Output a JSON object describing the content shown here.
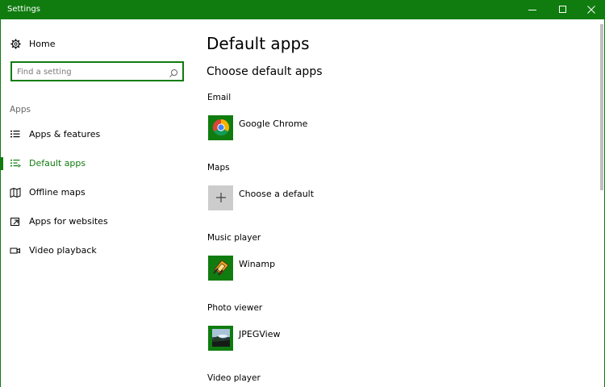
{
  "window": {
    "title": "Settings",
    "buttons": [
      "minimize",
      "maximize",
      "close"
    ],
    "accent_color": "#107c10"
  },
  "sidebar": {
    "home_label": "Home",
    "home_icon": "gear-icon",
    "search": {
      "placeholder": "Find a setting",
      "value": ""
    },
    "section_label": "Apps",
    "items": [
      {
        "label": "Apps & features",
        "icon": "list-icon",
        "active": false
      },
      {
        "label": "Default apps",
        "icon": "default-list-icon",
        "active": true
      },
      {
        "label": "Offline maps",
        "icon": "map-icon",
        "active": false
      },
      {
        "label": "Apps for websites",
        "icon": "open-window-icon",
        "active": false
      },
      {
        "label": "Video playback",
        "icon": "video-icon",
        "active": false
      }
    ]
  },
  "main": {
    "title": "Default apps",
    "subtitle": "Choose default apps",
    "categories": [
      {
        "label": "Email",
        "app": "Google Chrome",
        "icon": "chrome-icon"
      },
      {
        "label": "Maps",
        "app": "Choose a default",
        "icon": "plus-icon"
      },
      {
        "label": "Music player",
        "app": "Winamp",
        "icon": "winamp-icon"
      },
      {
        "label": "Photo viewer",
        "app": "JPEGView",
        "icon": "jpegview-icon"
      },
      {
        "label": "Video player",
        "app": "",
        "icon": ""
      }
    ]
  }
}
